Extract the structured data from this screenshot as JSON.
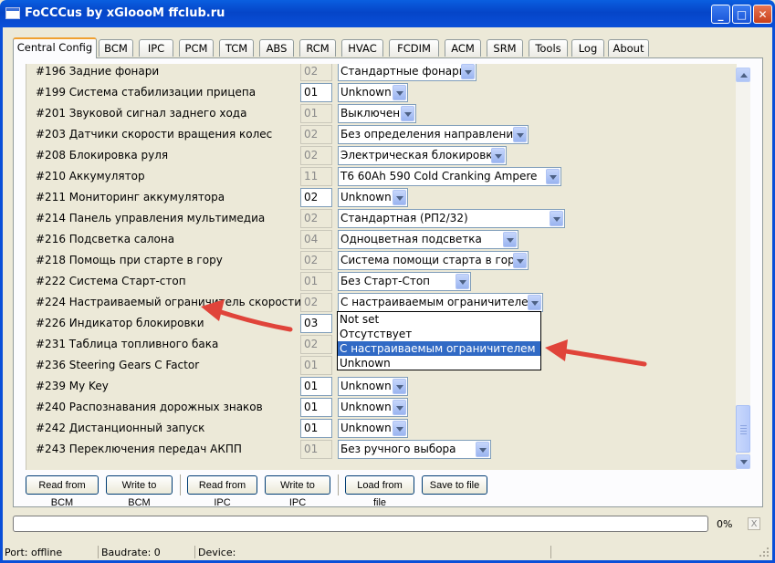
{
  "window": {
    "title": "FoCCCus by xGloooM ffclub.ru",
    "minimize_icon": "minimize-icon",
    "maximize_icon": "maximize-icon",
    "close_icon": "close-icon"
  },
  "tabs": [
    {
      "label": "Central Config",
      "active": true
    },
    {
      "label": "BCM"
    },
    {
      "label": "IPC"
    },
    {
      "label": "PCM"
    },
    {
      "label": "TCM"
    },
    {
      "label": "ABS"
    },
    {
      "label": "RCM"
    },
    {
      "label": "HVAC"
    },
    {
      "label": "FCDIM"
    },
    {
      "label": "ACM"
    },
    {
      "label": "SRM"
    },
    {
      "label": "Tools"
    },
    {
      "label": "Log"
    },
    {
      "label": "About"
    }
  ],
  "rows": [
    {
      "label": "#196 Задние фонари",
      "value": "02",
      "enabled": false,
      "selected": "Стандартные фонари"
    },
    {
      "label": "#199 Система стабилизации прицепа",
      "value": "01",
      "enabled": true,
      "selected": "Unknown"
    },
    {
      "label": "#201 Звуковой сигнал заднего хода",
      "value": "01",
      "enabled": false,
      "selected": "Выключен"
    },
    {
      "label": "#203 Датчики скорости вращения колес",
      "value": "02",
      "enabled": false,
      "selected": "Без определения направления"
    },
    {
      "label": "#208 Блокировка руля",
      "value": "02",
      "enabled": false,
      "selected": "Электрическая блокировка"
    },
    {
      "label": "#210 Аккумулятор",
      "value": "11",
      "enabled": false,
      "selected": "T6 60Ah 590 Cold Cranking Ampere"
    },
    {
      "label": "#211 Мониторинг аккумулятора",
      "value": "02",
      "enabled": true,
      "selected": "Unknown"
    },
    {
      "label": "#214 Панель управления мультимедиа",
      "value": "02",
      "enabled": false,
      "selected": "Стандартная (РП2/32)"
    },
    {
      "label": "#216 Подсветка салона",
      "value": "04",
      "enabled": false,
      "selected": "Одноцветная подсветка"
    },
    {
      "label": "#218 Помощь при старте в гору",
      "value": "02",
      "enabled": false,
      "selected": "Система помощи старта в гору"
    },
    {
      "label": "#222 Система Старт-стоп",
      "value": "01",
      "enabled": false,
      "selected": "Без Старт-Стоп"
    },
    {
      "label": "#224 Настраиваемый ограничитель скорости",
      "value": "02",
      "enabled": false,
      "selected": "С настраиваемым ограничителем"
    },
    {
      "label": "#226 Индикатор блокировки",
      "value": "03",
      "enabled": true,
      "selected": ""
    },
    {
      "label": "#231 Таблица топливного бака",
      "value": "02",
      "enabled": false,
      "selected": ""
    },
    {
      "label": "#236 Steering Gears C Factor",
      "value": "01",
      "enabled": false,
      "selected": ""
    },
    {
      "label": "#239 My Key",
      "value": "01",
      "enabled": true,
      "selected": "Unknown"
    },
    {
      "label": "#240 Распознавания дорожных знаков",
      "value": "01",
      "enabled": true,
      "selected": "Unknown"
    },
    {
      "label": "#242 Дистанционный запуск",
      "value": "01",
      "enabled": true,
      "selected": "Unknown"
    },
    {
      "label": "#243 Переключения передач АКПП",
      "value": "01",
      "enabled": false,
      "selected": "Без ручного выбора"
    }
  ],
  "dropdown": {
    "options": [
      {
        "label": "Not set"
      },
      {
        "label": "Отсутствует"
      },
      {
        "label": "С настраиваемым ограничителем",
        "highlighted": true
      },
      {
        "label": "Unknown"
      }
    ]
  },
  "buttons": {
    "read_bcm": "Read from BCM",
    "write_bcm": "Write to BCM",
    "read_ipc": "Read from IPC",
    "write_ipc": "Write to IPC",
    "load_file": "Load from file",
    "save_file": "Save to file"
  },
  "progress": {
    "percent_text": "0%",
    "fraction": 0.0,
    "cancel_label": "X"
  },
  "status": {
    "port": "Port: offline",
    "baudrate": "Baudrate: 0",
    "device": "Device:"
  },
  "colors": {
    "titlebar": "#0545c8",
    "selection": "#316ac5",
    "annotation_arrow": "#e0443a",
    "active_tab_accent": "#f0a030"
  }
}
